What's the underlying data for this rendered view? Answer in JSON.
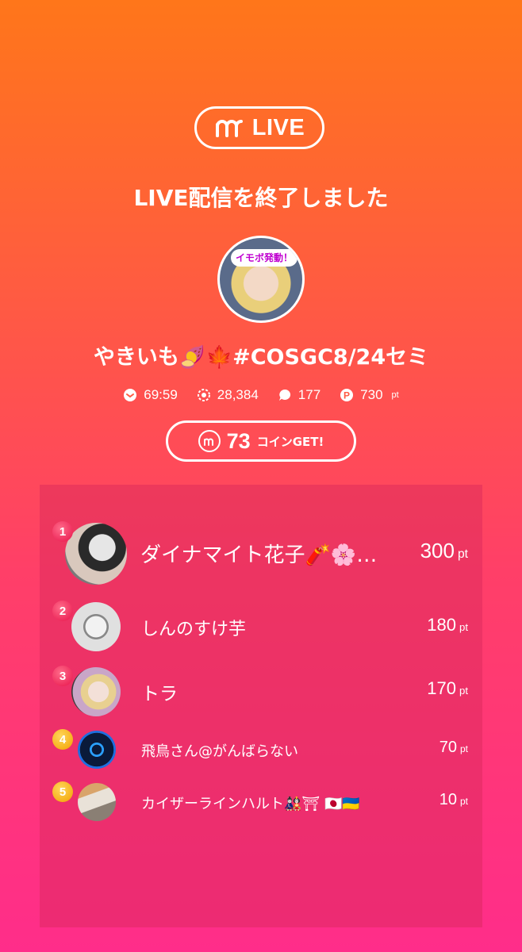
{
  "header": {
    "badge_label": "LIVE",
    "end_message": "LIVE配信を終了しました"
  },
  "streamer": {
    "avatar_banner": "イモボ発動！",
    "title": "やきいも🍠🍁#COSGC8/24セミ"
  },
  "stats": {
    "duration": "69:59",
    "viewers": "28,384",
    "comments": "177",
    "points": "730",
    "points_unit": "pt"
  },
  "coins": {
    "amount": "73",
    "label": "コインGET!"
  },
  "ranking": [
    {
      "rank": "1",
      "name": "ダイナマイト花子🧨🌸…",
      "points": "300",
      "unit": "pt"
    },
    {
      "rank": "2",
      "name": "しんのすけ芋",
      "points": "180",
      "unit": "pt"
    },
    {
      "rank": "3",
      "name": "トラ",
      "points": "170",
      "unit": "pt"
    },
    {
      "rank": "4",
      "name": "飛鳥さん@がんばらない",
      "points": "70",
      "unit": "pt"
    },
    {
      "rank": "5",
      "name": "カイザーラインハルト🎎⛩ 🇯🇵🇺🇦",
      "points": "10",
      "unit": "pt"
    }
  ],
  "colors": {
    "accent_top": "#ff761a",
    "accent_bottom": "#ff2d8a",
    "rank_red": "#e8124a",
    "rank_gold": "#f2a100"
  }
}
